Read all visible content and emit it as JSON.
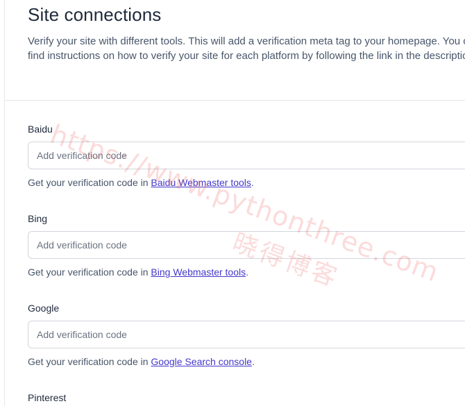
{
  "header": {
    "title": "Site connections",
    "description": "Verify your site with different tools. This will add a verification meta tag to your homepage. You can find instructions on how to verify your site for each platform by following the link in the description."
  },
  "fields": [
    {
      "label": "Baidu",
      "placeholder": "Add verification code",
      "help_prefix": "Get your verification code in ",
      "link_text": "Baidu Webmaster tools",
      "help_suffix": "."
    },
    {
      "label": "Bing",
      "placeholder": "Add verification code",
      "help_prefix": "Get your verification code in ",
      "link_text": "Bing Webmaster tools",
      "help_suffix": "."
    },
    {
      "label": "Google",
      "placeholder": "Add verification code",
      "help_prefix": "Get your verification code in ",
      "link_text": "Google Search console",
      "help_suffix": "."
    },
    {
      "label": "Pinterest"
    }
  ],
  "watermark": {
    "url": "https://www.pythonthree.com",
    "site_name": "晓得博客"
  },
  "colors": {
    "link": "#4338ca",
    "border": "#d1d5db",
    "watermark": "#eb5a5a"
  }
}
